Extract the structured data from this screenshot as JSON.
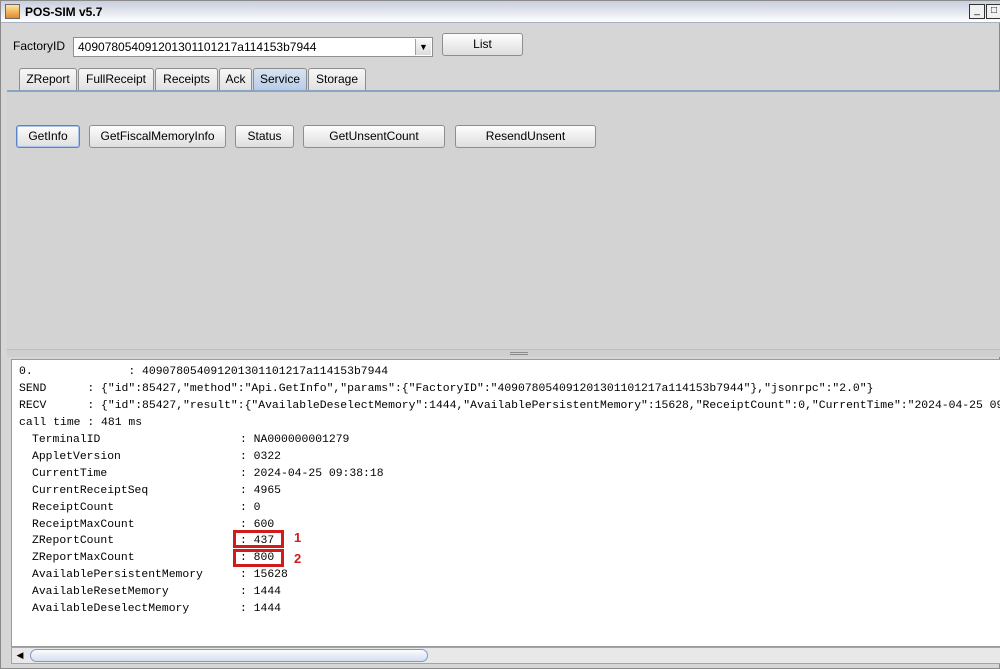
{
  "window": {
    "title": "POS-SIM v5.7",
    "minimize_glyph": "_",
    "maximize_glyph": "□"
  },
  "factory": {
    "label": "FactoryID",
    "selected_value": "409078054091201301101217a114153b7944",
    "arrow_glyph": "▼",
    "list_button": "List"
  },
  "tabs": [
    {
      "label": "ZReport",
      "active": false
    },
    {
      "label": "FullReceipt",
      "active": false
    },
    {
      "label": "Receipts",
      "active": false
    },
    {
      "label": "Ack",
      "active": false
    },
    {
      "label": "Service",
      "active": true
    },
    {
      "label": "Storage",
      "active": false
    }
  ],
  "service_buttons": [
    {
      "label": "GetInfo"
    },
    {
      "label": "GetFiscalMemoryInfo"
    },
    {
      "label": "Status"
    },
    {
      "label": "GetUnsentCount"
    },
    {
      "label": "ResendUnsent"
    }
  ],
  "log": {
    "lines": [
      "0.              : 409078054091201301101217a114153b7944",
      "SEND      : {\"id\":85427,\"method\":\"Api.GetInfo\",\"params\":{\"FactoryID\":\"409078054091201301101217a114153b7944\"},\"jsonrpc\":\"2.0\"}",
      "RECV      : {\"id\":85427,\"result\":{\"AvailableDeselectMemory\":1444,\"AvailablePersistentMemory\":15628,\"ReceiptCount\":0,\"CurrentTime\":\"2024-04-25 09",
      "call time : 481 ms"
    ],
    "fields": [
      {
        "key": "TerminalID",
        "value": ": NA000000001279"
      },
      {
        "key": "AppletVersion",
        "value": ": 0322"
      },
      {
        "key": "CurrentTime",
        "value": ": 2024-04-25 09:38:18"
      },
      {
        "key": "CurrentReceiptSeq",
        "value": ": 4965"
      },
      {
        "key": "ReceiptCount",
        "value": ": 0"
      },
      {
        "key": "ReceiptMaxCount",
        "value": ": 600"
      },
      {
        "key": "ZReportCount",
        "value": ": 437"
      },
      {
        "key": "ZReportMaxCount",
        "value": ": 800"
      },
      {
        "key": "AvailablePersistentMemory",
        "value": ": 15628"
      },
      {
        "key": "AvailableResetMemory",
        "value": ": 1444"
      },
      {
        "key": "AvailableDeselectMemory",
        "value": ": 1444"
      }
    ]
  },
  "annotations": [
    {
      "label": "1",
      "color": "#d11c1c"
    },
    {
      "label": "2",
      "color": "#d11c1c"
    }
  ],
  "scrollbar": {
    "left_glyph": "◀"
  }
}
